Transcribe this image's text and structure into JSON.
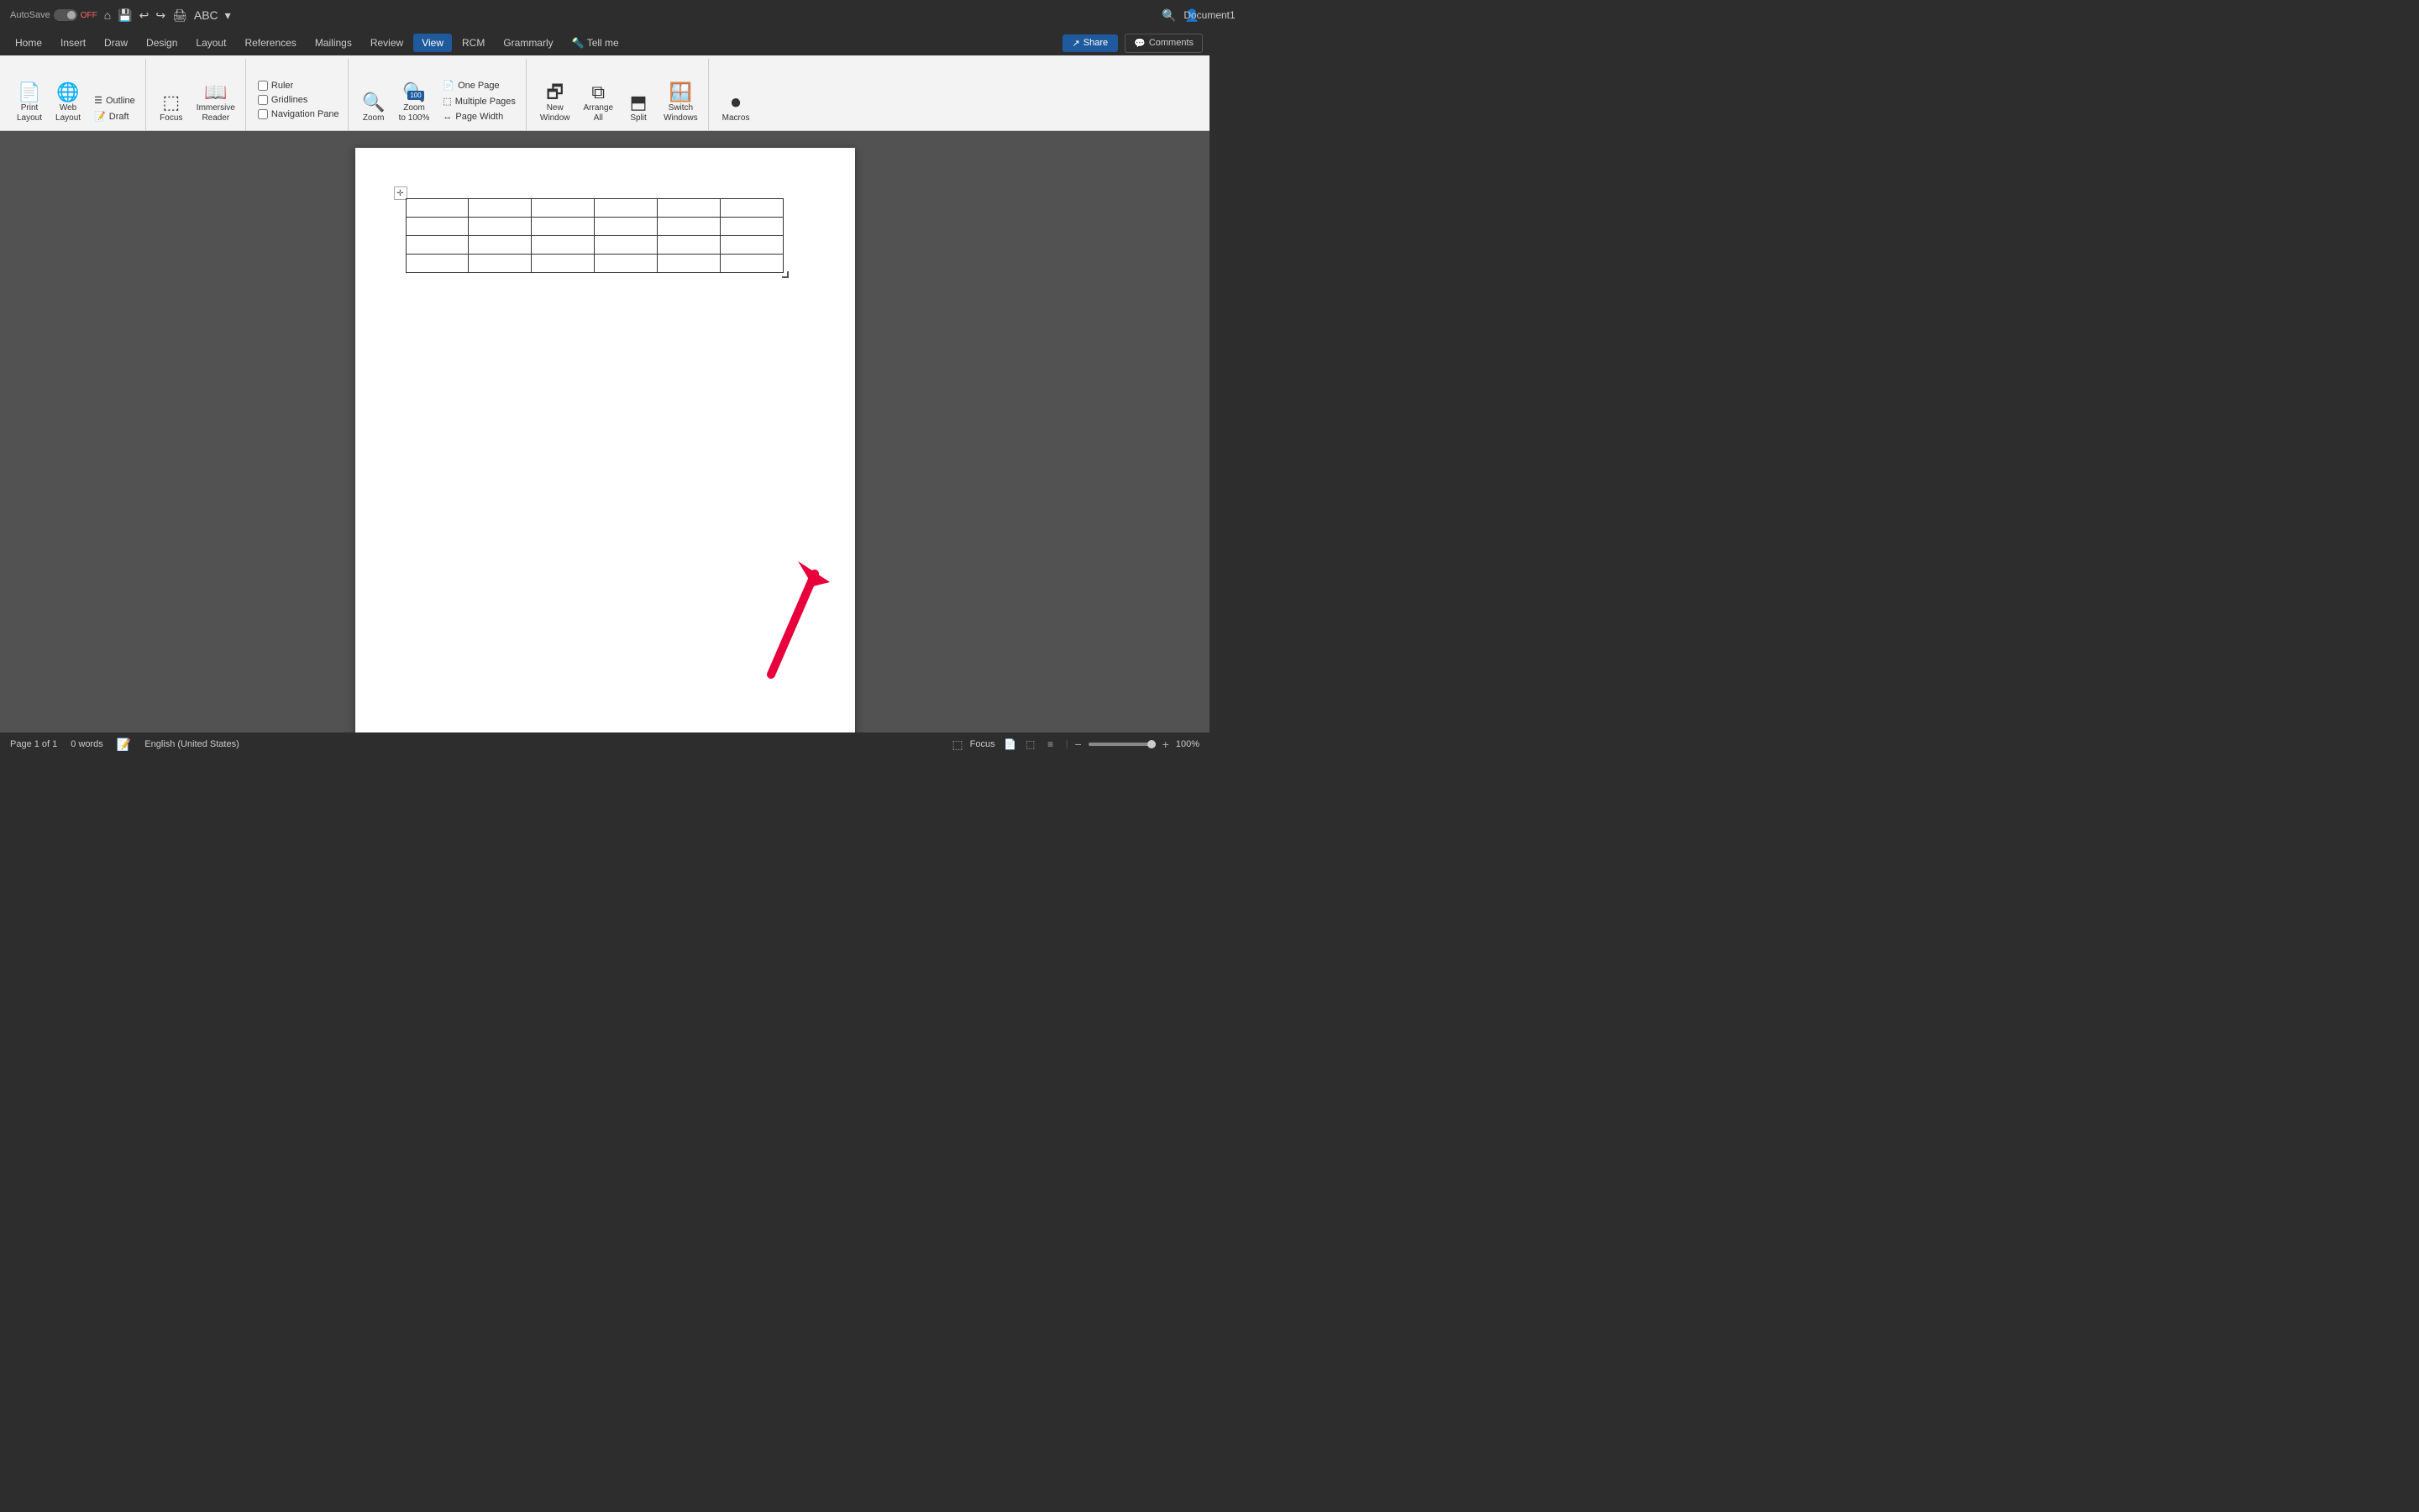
{
  "titleBar": {
    "autosave": "AutoSave",
    "autosave_state": "OFF",
    "document_title": "Document1"
  },
  "menuBar": {
    "items": [
      {
        "id": "home",
        "label": "Home"
      },
      {
        "id": "insert",
        "label": "Insert"
      },
      {
        "id": "draw",
        "label": "Draw"
      },
      {
        "id": "design",
        "label": "Design"
      },
      {
        "id": "layout",
        "label": "Layout"
      },
      {
        "id": "references",
        "label": "References"
      },
      {
        "id": "mailings",
        "label": "Mailings"
      },
      {
        "id": "review",
        "label": "Review"
      },
      {
        "id": "view",
        "label": "View"
      },
      {
        "id": "rcm",
        "label": "RCM"
      },
      {
        "id": "grammarly",
        "label": "Grammarly"
      },
      {
        "id": "tell_me",
        "label": "Tell me"
      }
    ],
    "share_label": "Share",
    "comments_label": "Comments"
  },
  "ribbon": {
    "view_tab": {
      "groups": [
        {
          "id": "views",
          "items": [
            {
              "id": "print-layout",
              "icon": "📄",
              "label": "Print\nLayout"
            },
            {
              "id": "web-layout",
              "icon": "🌐",
              "label": "Web\nLayout"
            },
            {
              "id": "outline",
              "icon": "☰",
              "label": "Outline"
            },
            {
              "id": "draft",
              "icon": "📝",
              "label": "Draft"
            }
          ]
        },
        {
          "id": "immersive",
          "items": [
            {
              "id": "focus",
              "icon": "⬚",
              "label": "Focus"
            },
            {
              "id": "immersive-reader",
              "icon": "📖",
              "label": "Immersive\nReader"
            }
          ]
        },
        {
          "id": "show",
          "checkboxes": [
            {
              "id": "ruler",
              "label": "Ruler"
            },
            {
              "id": "gridlines",
              "label": "Gridlines"
            },
            {
              "id": "navigation-pane",
              "label": "Navigation Pane"
            }
          ]
        },
        {
          "id": "zoom",
          "items": [
            {
              "id": "zoom",
              "icon": "🔍",
              "label": "Zoom"
            },
            {
              "id": "zoom-100",
              "icon": "🔍",
              "label": "Zoom\nto 100%",
              "badge": "100"
            }
          ],
          "sub_items": [
            {
              "id": "one-page",
              "label": "One Page"
            },
            {
              "id": "multiple-pages",
              "label": "Multiple Pages"
            },
            {
              "id": "page-width",
              "label": "Page Width"
            }
          ]
        },
        {
          "id": "window",
          "items": [
            {
              "id": "new-window",
              "icon": "🗗",
              "label": "New\nWindow"
            },
            {
              "id": "arrange-all",
              "icon": "⧉",
              "label": "Arrange\nAll"
            },
            {
              "id": "split",
              "icon": "⬒",
              "label": "Split"
            },
            {
              "id": "switch-windows",
              "icon": "🪟",
              "label": "Switch\nWindows"
            }
          ]
        },
        {
          "id": "macros",
          "items": [
            {
              "id": "macros",
              "icon": "⏺",
              "label": "Macros"
            }
          ]
        }
      ]
    }
  },
  "statusBar": {
    "page_info": "Page 1 of 1",
    "words": "0 words",
    "language": "English (United States)",
    "zoom_level": "100%"
  },
  "table": {
    "rows": 4,
    "cols": 6
  }
}
